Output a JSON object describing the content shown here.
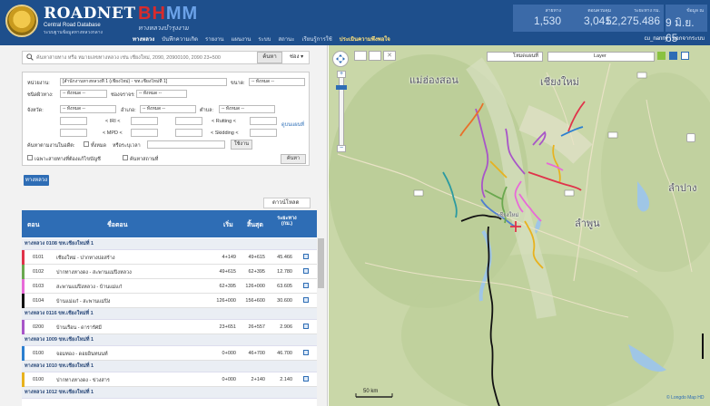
{
  "header": {
    "logo_title": "ROADNET",
    "logo_sub1": "Central Road Database",
    "logo_sub2": "ระบบฐานข้อมูลทางหลวงกลาง",
    "bhmm_b": "BH",
    "bhmm_mm": "MM",
    "bhmm_sub": "ทางหลวงบำรุงงาม",
    "nav": [
      "ทางหลวง",
      "บันทึกความเกิด",
      "รายงาน",
      "แผนงาน",
      "ระบบ",
      "สถานะ",
      "เรียนรู้การใช้",
      "ประเมินความพึงพอใจ"
    ],
    "stats": [
      {
        "label": "สายทาง",
        "value": "1,530"
      },
      {
        "label": "ตอนควบคุม",
        "value": "3,041"
      },
      {
        "label": "ระยะทาง กม.",
        "value": "52,275.486"
      },
      {
        "label": "ข้อมูล ณ",
        "value": "9 มิ.ย. 65"
      }
    ],
    "user": "cu_nanny | ออกจากระบบ"
  },
  "search": {
    "placeholder": "ค้นหาสายทาง หรือ หมายเลขทางหลวง เช่น เชียงใหม่, 2090, 20900100, 2090 23+500",
    "button": "ค้นหา",
    "options": "ช่อง ▾"
  },
  "filters": {
    "agency_label": "หน่วยงาน:",
    "agency_value": "[สำนักงานทางหลวงที่ 1 (เชียงใหม่) - ขท.เชียงใหม่ที่ 1]",
    "lanes_label": "ขนาด:",
    "lanes_value": "-- ทั้งหมด --",
    "type_label": "ชนิดผิวทาง:",
    "type_value": "-- ทั้งหมด --",
    "class_label": "ช่องจราจร:",
    "class_value": "-- ทั้งหมด --",
    "province_label": "จังหวัด:",
    "province_value": "-- ทั้งหมด --",
    "district_label": "อำเภอ:",
    "district_value": "-- ทั้งหมด --",
    "subdistrict_label": "ตำบล:",
    "subdistrict_value": "-- ทั้งหมด --",
    "iri_label": "< IRI <",
    "rutting_label": "< Rutting <",
    "mpd_label": "< MPD <",
    "skid_label": "< Skidding <",
    "year_label": "ค้นหาตามงานในอดีต:",
    "year_check_label": "ทั้งหมด",
    "year_or": "หรือระบุเวลา",
    "apply": "ใช้งาน",
    "only_my_label": "เฉพาะสายทางที่ต้องแก้ไขบัญชี",
    "expired_label": "ค้นหาสถานที่",
    "search_btn": "ค้นหา",
    "view_map": "ดูบนแผนที่"
  },
  "tab_label": "ทางหลวง",
  "download_label": "ดาวน์โหลด",
  "table": {
    "headers": {
      "code": "ตอน",
      "name": "ชื่อตอน",
      "start": "เริ่ม",
      "end": "สิ้นสุด",
      "dist": "ระยะทาง (กม.)"
    },
    "groups": [
      {
        "title": "ทางหลวง 0108 ขท.เชียงใหม่ที่ 1",
        "rows": [
          {
            "code": "0101",
            "name": "เชียงใหม่ - ปากทางบ่อสร้าง",
            "start": "4+149",
            "end": "49+615",
            "dist": "45.466",
            "color": "#e0334a"
          },
          {
            "code": "0102",
            "name": "ปากทางหางดง - สะพานแม่ปิงหลวง",
            "start": "49+615",
            "end": "62+395",
            "dist": "12.780",
            "color": "#6aa84f"
          },
          {
            "code": "0103",
            "name": "สะพานแม่ปิงหลวง - บ้านแม่แก๋",
            "start": "62+395",
            "end": "126+000",
            "dist": "63.605",
            "color": "#e86ad8"
          },
          {
            "code": "0104",
            "name": "บ้านแม่แก๋ - สะพานแม่ปิง",
            "start": "126+000",
            "end": "156+600",
            "dist": "30.600",
            "color": "#111111"
          }
        ]
      },
      {
        "title": "ทางหลวง 0116 ขท.เชียงใหม่ที่ 1",
        "rows": [
          {
            "code": "0200",
            "name": "บ้านเรือน - ดารารัศมี",
            "start": "23+651",
            "end": "26+557",
            "dist": "2.906",
            "color": "#a855c8"
          }
        ]
      },
      {
        "title": "ทางหลวง 1009 ขท.เชียงใหม่ที่ 1",
        "rows": [
          {
            "code": "0100",
            "name": "จอมทอง - ดอยอินทนนท์",
            "start": "0+000",
            "end": "46+700",
            "dist": "46.700",
            "color": "#2b7fd0"
          }
        ]
      },
      {
        "title": "ทางหลวง 1010 ขท.เชียงใหม่ที่ 1",
        "rows": [
          {
            "code": "0100",
            "name": "ปากทางหางดง - ข่วงสาร",
            "start": "0+000",
            "end": "2+140",
            "dist": "2.140",
            "color": "#e8b21e"
          }
        ]
      },
      {
        "title": "ทางหลวง 1012 ขท.เชียงใหม่ที่ 1",
        "rows": []
      }
    ]
  },
  "map": {
    "type_select": "โหมดแผนที่",
    "layer_select": "Layer",
    "labels": {
      "maehongson": "แม่ฮ่องสอน",
      "chiangmai": "เชียงใหม่",
      "lamphun": "ลำพูน",
      "lampang": "ลำปาง",
      "chiangmai_small": "เชียงใหม่"
    },
    "scale": "50 km",
    "attribution": "© Longdo Map HD"
  },
  "colors": {
    "header_bg": "#1e4f8c",
    "accent": "#2e6db5",
    "map_bg": "#c7d6a6"
  }
}
